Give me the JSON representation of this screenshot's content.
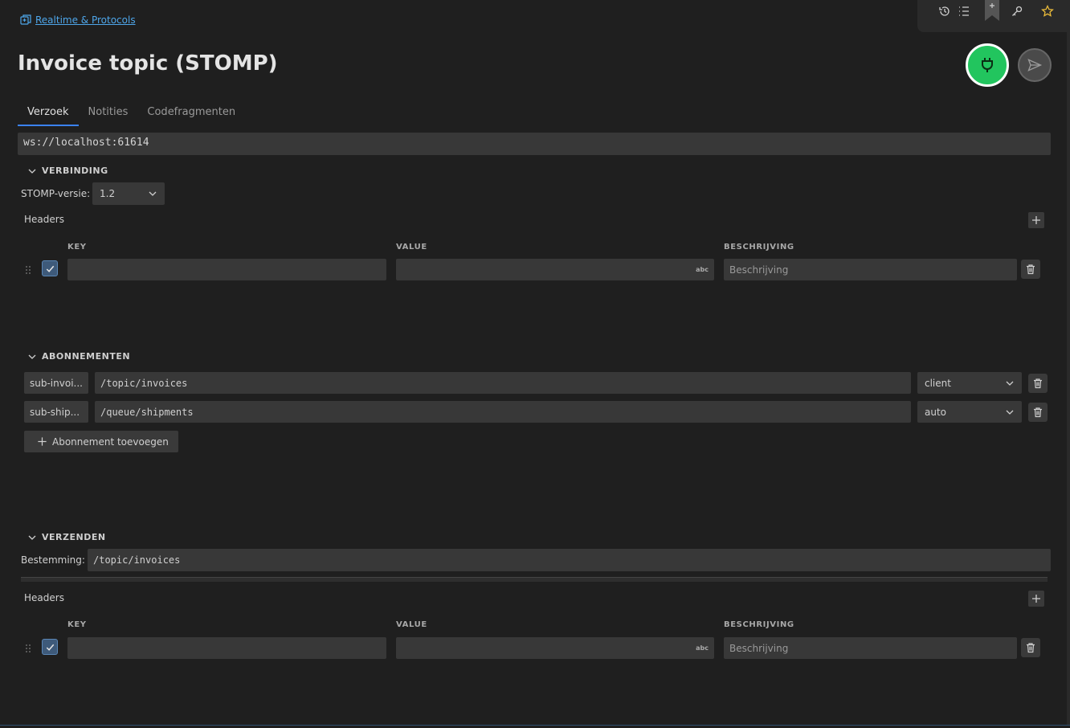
{
  "breadcrumb": {
    "label": "Realtime & Protocols"
  },
  "title": "Invoice topic (STOMP)",
  "tabs": [
    {
      "label": "Verzoek",
      "active": true
    },
    {
      "label": "Notities",
      "active": false
    },
    {
      "label": "Codefragmenten",
      "active": false
    }
  ],
  "url": "ws://localhost:61614",
  "connection": {
    "section_label": "VERBINDING",
    "stomp_version_label": "STOMP-versie:",
    "stomp_version_value": "1.2",
    "headers_label": "Headers",
    "columns": {
      "key": "KEY",
      "value": "VALUE",
      "description": "BESCHRIJVING"
    },
    "rows": [
      {
        "checked": true,
        "key": "",
        "value": "",
        "value_type": "abc",
        "description": "Beschrijving"
      }
    ]
  },
  "subscriptions": {
    "section_label": "ABONNEMENTEN",
    "items": [
      {
        "id": "sub-invoi...",
        "destination": "/topic/invoices",
        "ack": "client"
      },
      {
        "id": "sub-ship...",
        "destination": "/queue/shipments",
        "ack": "auto"
      }
    ],
    "add_label": "Abonnement toevoegen"
  },
  "send": {
    "section_label": "VERZENDEN",
    "destination_label": "Bestemming:",
    "destination_value": "/topic/invoices",
    "headers_label": "Headers",
    "columns": {
      "key": "KEY",
      "value": "VALUE",
      "description": "BESCHRIJVING"
    },
    "rows": [
      {
        "checked": true,
        "key": "",
        "value": "",
        "value_type": "abc",
        "description": "Beschrijving"
      }
    ]
  },
  "colors": {
    "accent": "#3b82f6",
    "connect": "#22c55e",
    "link": "#4ea6ea",
    "background": "#1f1f1f"
  },
  "icons": {
    "breadcrumb": "collection-icon",
    "toolbar": [
      "history-icon",
      "list-icon",
      "bookmark-icon",
      "key-icon",
      "star-icon"
    ],
    "connect": "plug-icon",
    "send": "send-icon"
  }
}
